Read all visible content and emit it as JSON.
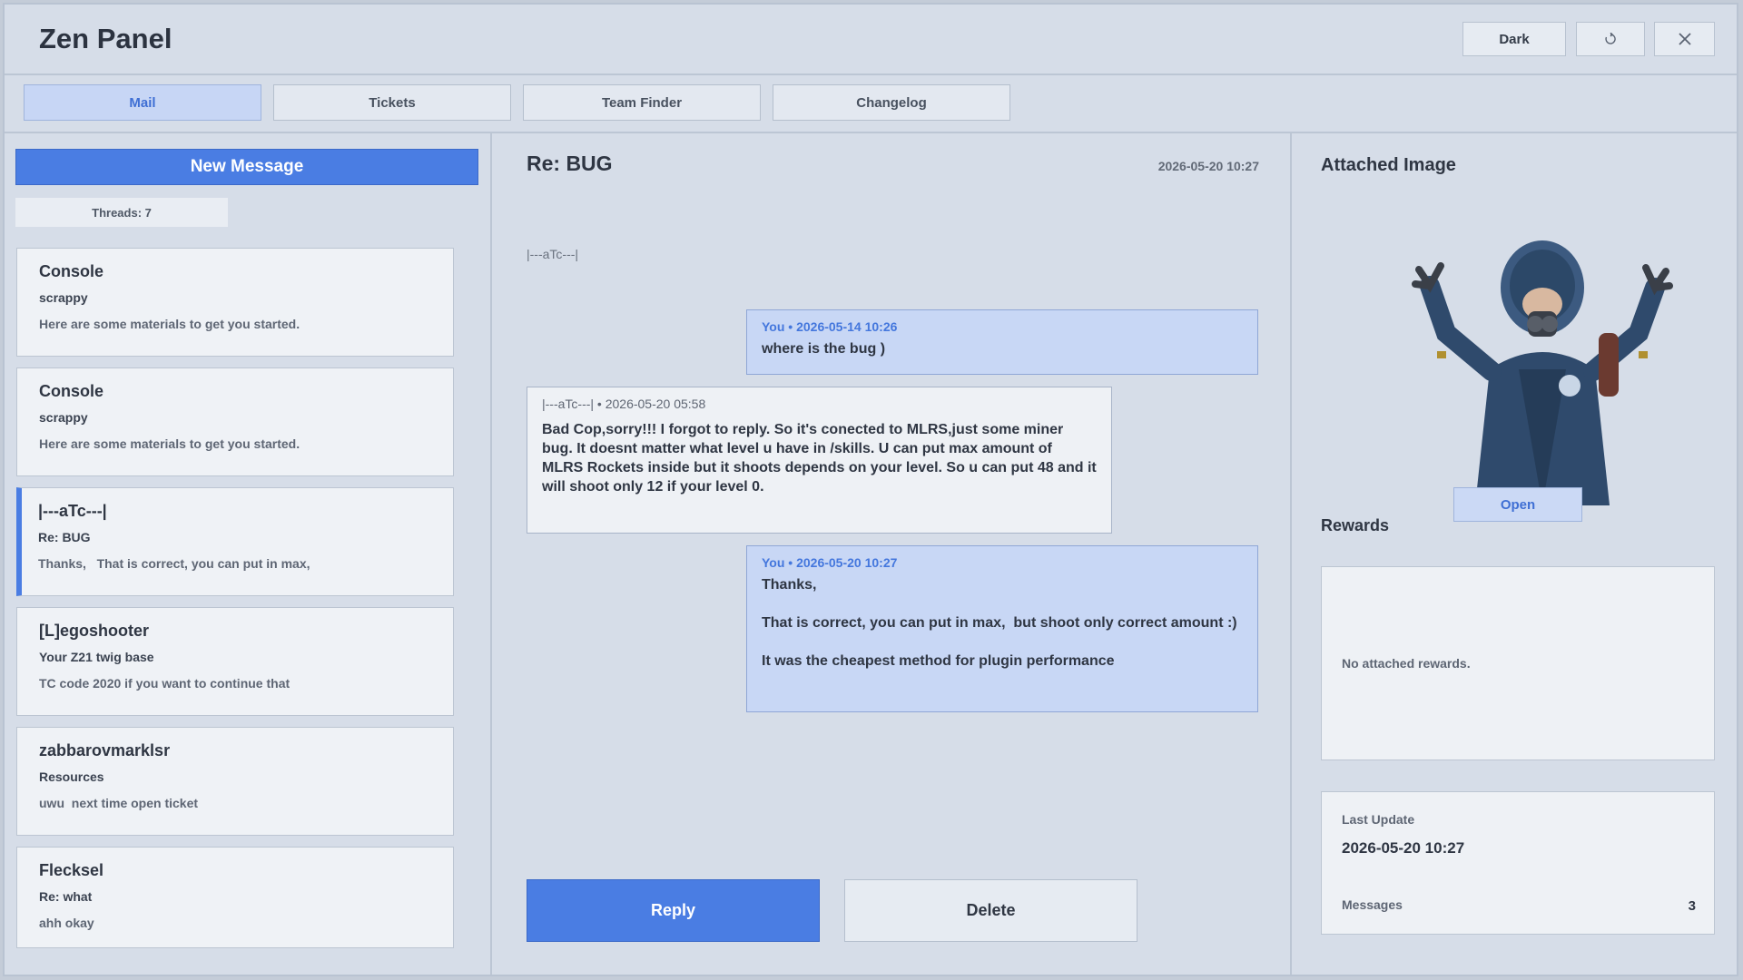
{
  "app": {
    "title": "Zen Panel",
    "theme_button": "Dark",
    "refresh_icon": "refresh-icon",
    "close_icon": "close-icon"
  },
  "tabs": [
    {
      "label": "Mail",
      "active": true
    },
    {
      "label": "Tickets",
      "active": false
    },
    {
      "label": "Team Finder",
      "active": false
    },
    {
      "label": "Changelog",
      "active": false
    }
  ],
  "sidebar": {
    "new_message": "New Message",
    "threads_count": "Threads: 7",
    "threads": [
      {
        "from": "Console",
        "subject": "scrappy",
        "preview": "Here are some materials to get you started."
      },
      {
        "from": "Console",
        "subject": "scrappy",
        "preview": "Here are some materials to get you started."
      },
      {
        "from": "|---aTc---|",
        "subject": "Re: BUG",
        "preview": "Thanks,   That is correct, you can put in max,",
        "selected": true
      },
      {
        "from": "[L]egoshooter",
        "subject": "Your Z21 twig base",
        "preview": "TC code 2020 if you want to continue that"
      },
      {
        "from": "zabbarovmarklsr",
        "subject": "Resources",
        "preview": "uwu  next time open ticket"
      },
      {
        "from": "Flecksel",
        "subject": "Re: what",
        "preview": "ahh okay"
      }
    ]
  },
  "conversation": {
    "title": "Re: BUG",
    "date": "2026-05-20 10:27",
    "with": "|---aTc---|",
    "messages": [
      {
        "author": "me",
        "meta": "You • 2026-05-14 10:26",
        "body": "where is the bug )"
      },
      {
        "author": "them",
        "meta": "|---aTc---| • 2026-05-20 05:58",
        "body": "Bad Cop,sorry!!! I forgot to reply. So it's conected to MLRS,just some miner bug. It doesnt matter what level u have in /skills. U can put max amount of MLRS Rockets inside but it shoots depends on your level. So u can put 48 and it will shoot only 12 if your level 0."
      },
      {
        "author": "me",
        "meta": "You • 2026-05-20 10:27",
        "body": "Thanks,\n\nThat is correct, you can put in max,  but shoot only correct amount :)\n\nIt was the cheapest method for plugin performance"
      }
    ],
    "reply_label": "Reply",
    "delete_label": "Delete"
  },
  "details": {
    "attached_heading": "Attached Image",
    "open_label": "Open",
    "rewards_heading": "Rewards",
    "rewards_empty": "No attached rewards.",
    "last_update_label": "Last Update",
    "last_update_value": "2026-05-20 10:27",
    "messages_label": "Messages",
    "messages_value": "3"
  },
  "colors": {
    "accent": "#4a7de3",
    "bubble_me": "#c8d7f5",
    "panel_bg": "#d6dde8"
  }
}
